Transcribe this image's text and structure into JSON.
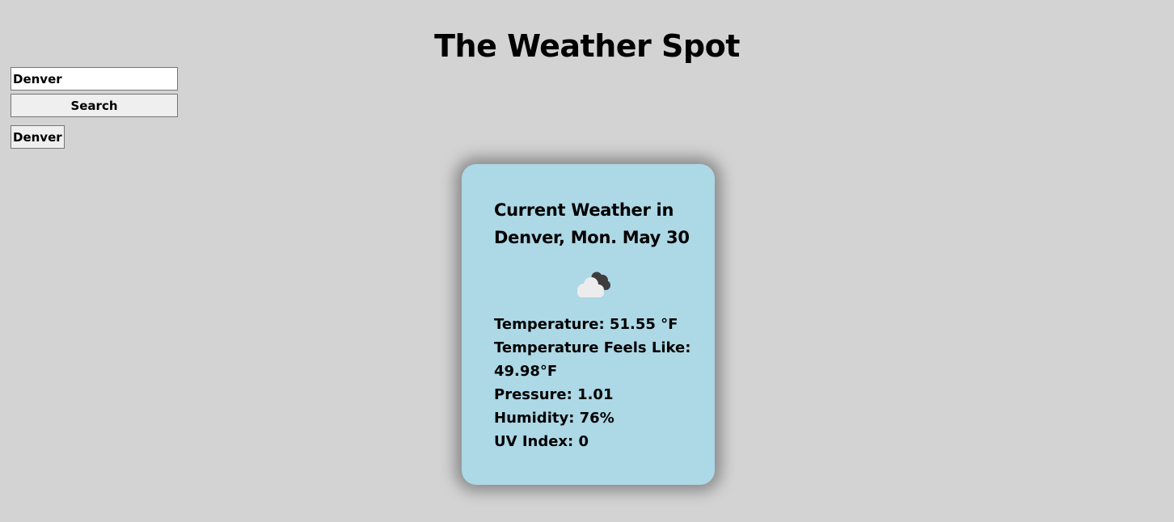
{
  "header": {
    "title": "The Weather Spot"
  },
  "search": {
    "input_value": "Denver",
    "button_label": "Search"
  },
  "history": {
    "items": [
      "Denver"
    ]
  },
  "weather": {
    "heading": "Current Weather in Denver, Mon. May 30",
    "icon": "broken-clouds-icon",
    "temperature": "Temperature: 51.55 °F",
    "feels_like_label": "Temperature Feels Like:",
    "feels_like_value": "49.98°F",
    "pressure": "Pressure: 1.01",
    "humidity": "Humidity: 76%",
    "uv_index": "UV Index: 0"
  },
  "colors": {
    "page_background": "#d3d3d3",
    "card_background": "#add8e6"
  }
}
